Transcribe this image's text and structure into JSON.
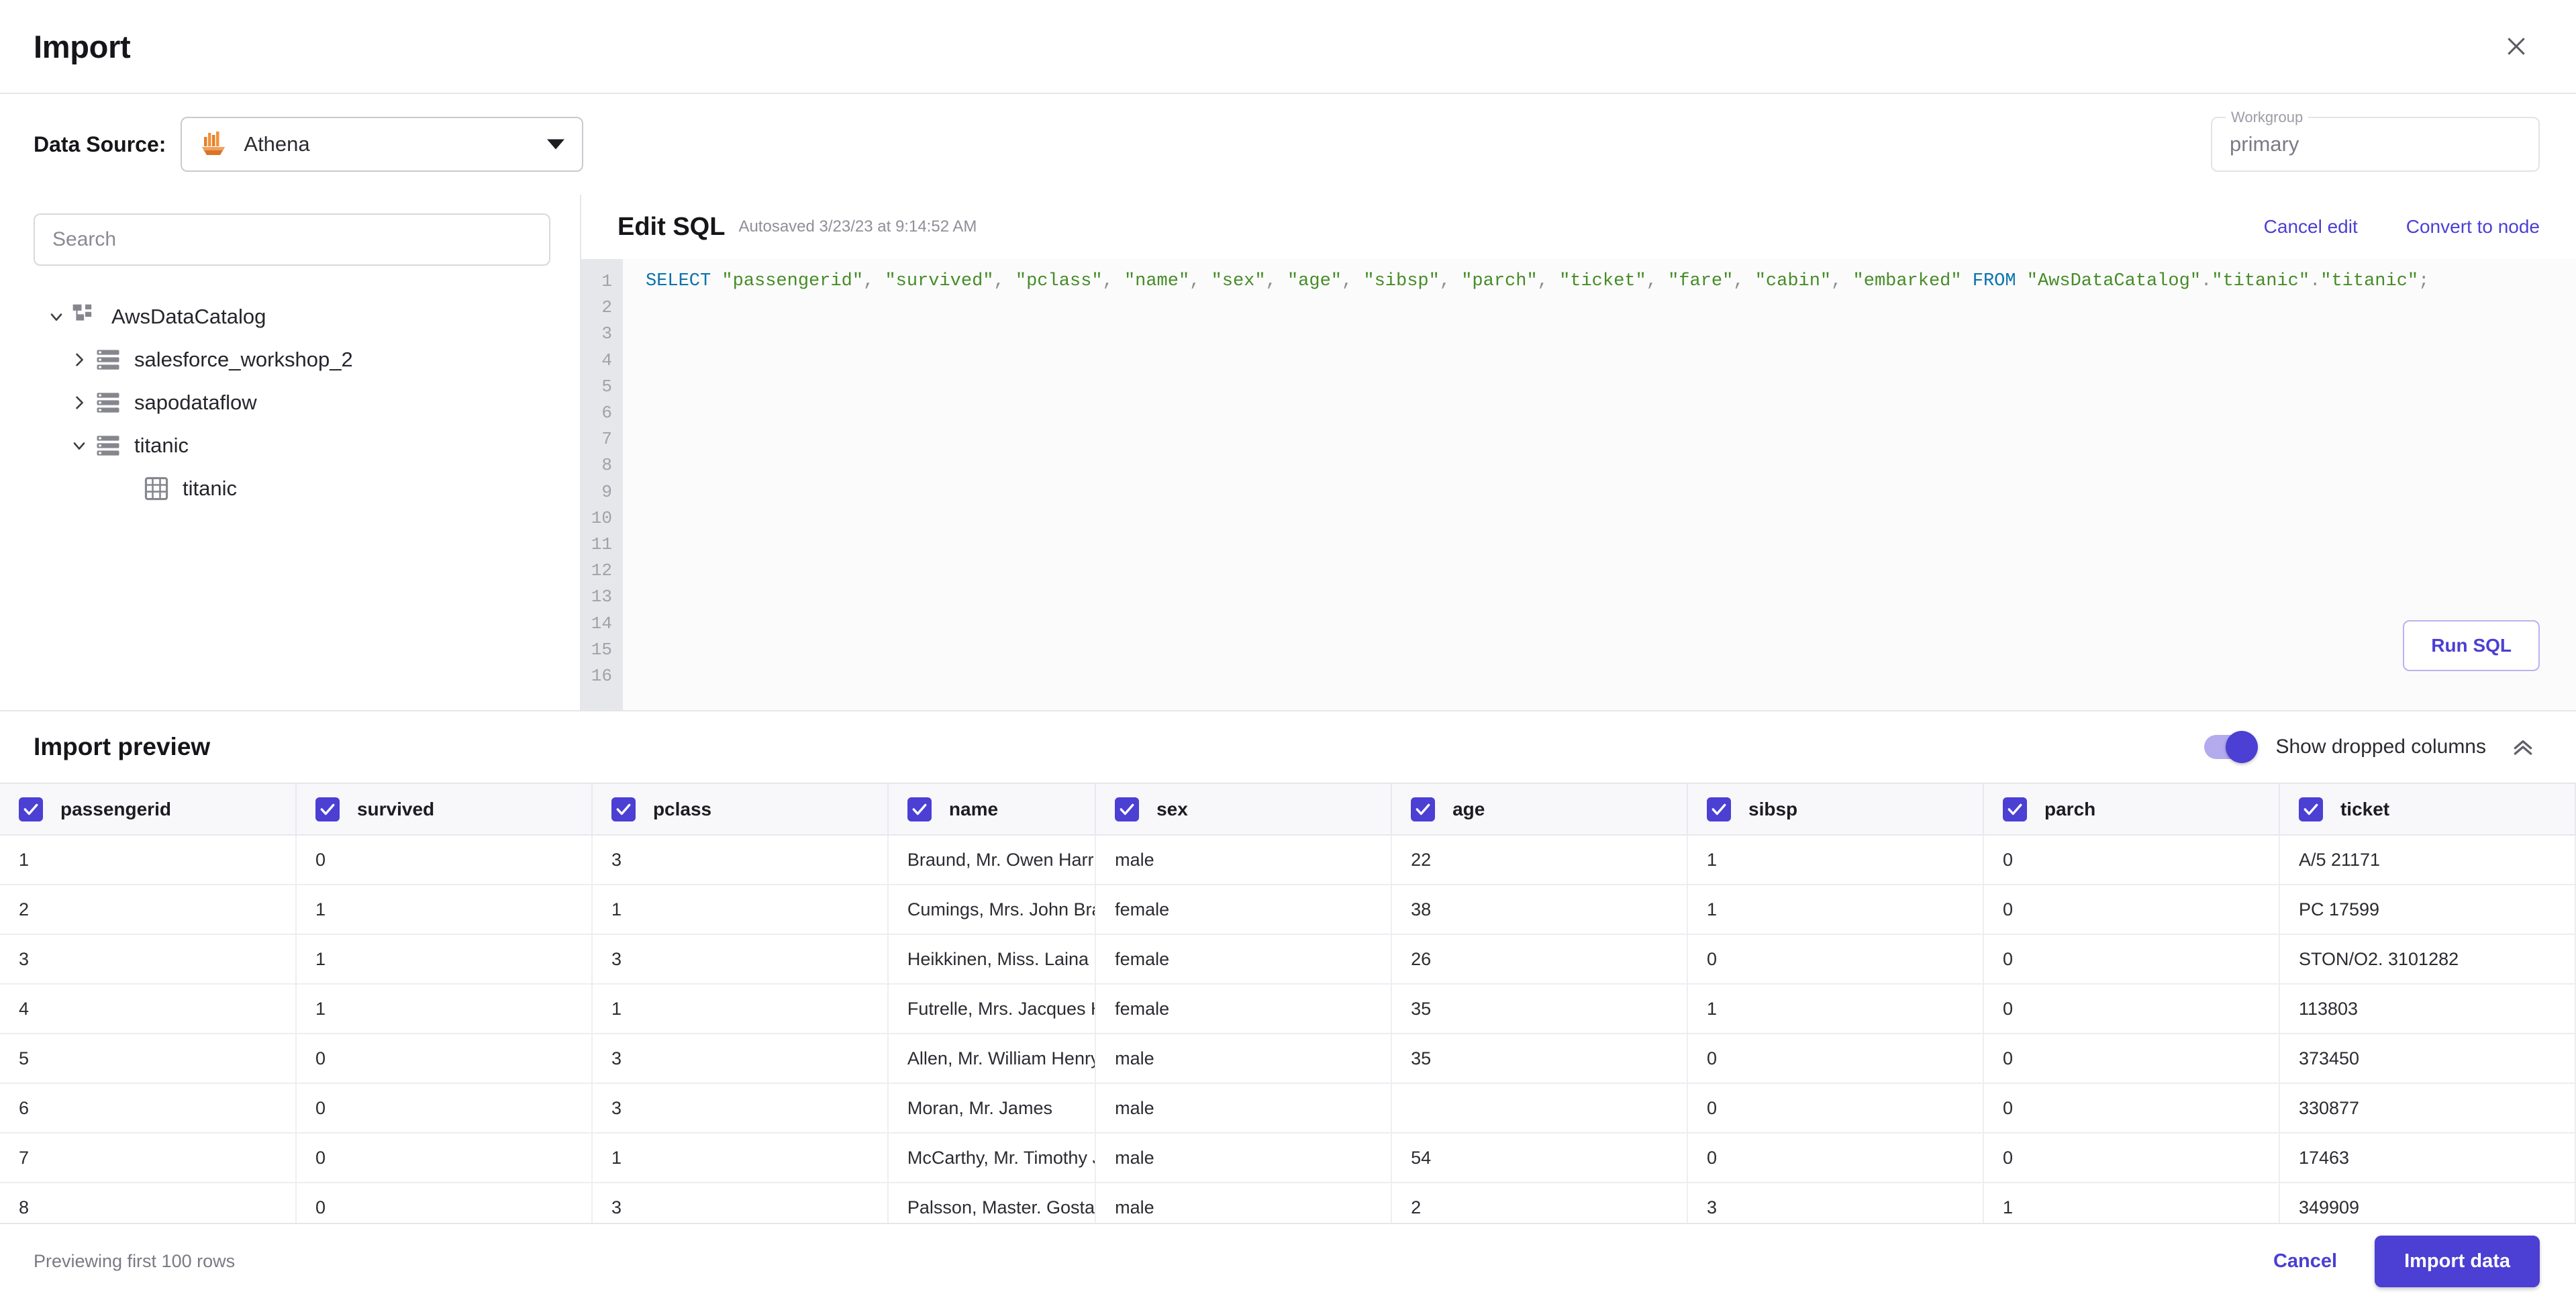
{
  "header": {
    "title": "Import",
    "close_icon": "close-icon"
  },
  "source": {
    "label": "Data Source:",
    "selected": "Athena",
    "icon": "athena-icon",
    "workgroup_label": "Workgroup",
    "workgroup_value": "primary"
  },
  "sidebar": {
    "search_placeholder": "Search",
    "tree": [
      {
        "label": "AwsDataCatalog",
        "level": 0,
        "expanded": true,
        "icon": "catalog-icon"
      },
      {
        "label": "salesforce_workshop_2",
        "level": 1,
        "expanded": false,
        "icon": "database-icon"
      },
      {
        "label": "sapodataflow",
        "level": 1,
        "expanded": false,
        "icon": "database-icon"
      },
      {
        "label": "titanic",
        "level": 1,
        "expanded": true,
        "icon": "database-icon"
      },
      {
        "label": "titanic",
        "level": 2,
        "expanded": null,
        "icon": "table-icon"
      }
    ]
  },
  "sql": {
    "title": "Edit SQL",
    "autosaved": "Autosaved 3/23/23 at 9:14:52 AM",
    "cancel_edit": "Cancel edit",
    "convert_to_node": "Convert to node",
    "run_button": "Run SQL",
    "line_numbers": [
      "1",
      "2",
      "3",
      "4",
      "5",
      "6",
      "7",
      "8",
      "9",
      "10",
      "11",
      "12",
      "13",
      "14",
      "15",
      "16"
    ],
    "query_tokens": [
      {
        "t": "SELECT",
        "k": "kw"
      },
      {
        "t": " ",
        "k": "pun"
      },
      {
        "t": "\"passengerid\"",
        "k": "str"
      },
      {
        "t": ", ",
        "k": "pun"
      },
      {
        "t": "\"survived\"",
        "k": "str"
      },
      {
        "t": ", ",
        "k": "pun"
      },
      {
        "t": "\"pclass\"",
        "k": "str"
      },
      {
        "t": ", ",
        "k": "pun"
      },
      {
        "t": "\"name\"",
        "k": "str"
      },
      {
        "t": ", ",
        "k": "pun"
      },
      {
        "t": "\"sex\"",
        "k": "str"
      },
      {
        "t": ", ",
        "k": "pun"
      },
      {
        "t": "\"age\"",
        "k": "str"
      },
      {
        "t": ", ",
        "k": "pun"
      },
      {
        "t": "\"sibsp\"",
        "k": "str"
      },
      {
        "t": ", ",
        "k": "pun"
      },
      {
        "t": "\"parch\"",
        "k": "str"
      },
      {
        "t": ", ",
        "k": "pun"
      },
      {
        "t": "\"ticket\"",
        "k": "str"
      },
      {
        "t": ", ",
        "k": "pun"
      },
      {
        "t": "\"fare\"",
        "k": "str"
      },
      {
        "t": ", ",
        "k": "pun"
      },
      {
        "t": "\"cabin\"",
        "k": "str"
      },
      {
        "t": ", ",
        "k": "pun"
      },
      {
        "t": "\"embarked\"",
        "k": "str"
      },
      {
        "t": " ",
        "k": "pun"
      },
      {
        "t": "FROM",
        "k": "kw"
      },
      {
        "t": " ",
        "k": "pun"
      },
      {
        "t": "\"AwsDataCatalog\"",
        "k": "str"
      },
      {
        "t": ".",
        "k": "pun"
      },
      {
        "t": "\"titanic\"",
        "k": "str"
      },
      {
        "t": ".",
        "k": "pun"
      },
      {
        "t": "\"titanic\"",
        "k": "str"
      },
      {
        "t": ";",
        "k": "pun"
      }
    ]
  },
  "preview": {
    "title": "Import preview",
    "toggle_label": "Show dropped columns",
    "toggle_on": true,
    "collapse_icon": "chevron-double-up-icon",
    "columns": [
      "passengerid",
      "survived",
      "pclass",
      "name",
      "sex",
      "age",
      "sibsp",
      "parch",
      "ticket"
    ],
    "columns_checked": [
      true,
      true,
      true,
      true,
      true,
      true,
      true,
      true,
      true
    ],
    "rows": [
      [
        "1",
        "0",
        "3",
        "Braund, Mr. Owen Harris",
        "male",
        "22",
        "1",
        "0",
        "A/5 21171"
      ],
      [
        "2",
        "1",
        "1",
        "Cumings, Mrs. John Bradley (Florence Briggs Thayer)",
        "female",
        "38",
        "1",
        "0",
        "PC 17599"
      ],
      [
        "3",
        "1",
        "3",
        "Heikkinen, Miss. Laina",
        "female",
        "26",
        "0",
        "0",
        "STON/O2. 3101282"
      ],
      [
        "4",
        "1",
        "1",
        "Futrelle, Mrs. Jacques Heath (Lily May Peel)",
        "female",
        "35",
        "1",
        "0",
        "113803"
      ],
      [
        "5",
        "0",
        "3",
        "Allen, Mr. William Henry",
        "male",
        "35",
        "0",
        "0",
        "373450"
      ],
      [
        "6",
        "0",
        "3",
        "Moran, Mr. James",
        "male",
        "",
        "0",
        "0",
        "330877"
      ],
      [
        "7",
        "0",
        "1",
        "McCarthy, Mr. Timothy J",
        "male",
        "54",
        "0",
        "0",
        "17463"
      ],
      [
        "8",
        "0",
        "3",
        "Palsson, Master. Gosta Leonard",
        "male",
        "2",
        "3",
        "1",
        "349909"
      ]
    ]
  },
  "footer": {
    "note": "Previewing first 100 rows",
    "cancel": "Cancel",
    "import": "Import data"
  },
  "colors": {
    "accent": "#4b3fd4",
    "sql_keyword": "#0b72ad",
    "sql_string": "#468c27",
    "athena_orange": "#e8802a"
  }
}
